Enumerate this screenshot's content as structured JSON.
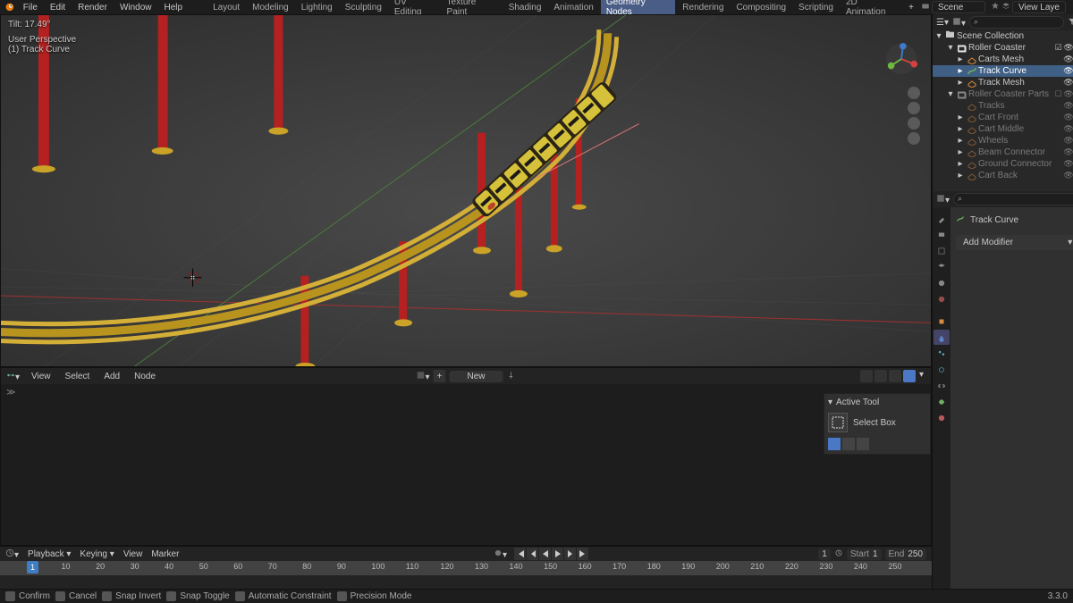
{
  "menu": [
    "File",
    "Edit",
    "Render",
    "Window",
    "Help"
  ],
  "workspaces": [
    "Layout",
    "Modeling",
    "Lighting",
    "Sculpting",
    "UV Editing",
    "Texture Paint",
    "Shading",
    "Animation",
    "Geometry Nodes",
    "Rendering",
    "Compositing",
    "Scripting",
    "2D Animation"
  ],
  "active_workspace": "Geometry Nodes",
  "scene_name": "Scene",
  "view_layer": "View Layer",
  "viewport": {
    "tilt_text": "Tilt: 17.49°",
    "persp_label": "User Perspective",
    "object_label": "(1) Track Curve"
  },
  "node_editor": {
    "menus": [
      "View",
      "Select",
      "Add",
      "Node"
    ],
    "new_label": "New",
    "panel_title": "Active Tool",
    "tool_label": "Select Box"
  },
  "timeline": {
    "menus": [
      "Playback",
      "Keying",
      "View",
      "Marker"
    ],
    "frame_field": "1",
    "start_label": "Start",
    "start_value": "1",
    "end_label": "End",
    "end_value": "250",
    "current": "1",
    "ticks": [
      "10",
      "20",
      "30",
      "40",
      "50",
      "60",
      "70",
      "80",
      "90",
      "100",
      "110",
      "120",
      "130",
      "140",
      "150",
      "160",
      "170",
      "180",
      "190",
      "200",
      "210",
      "220",
      "230",
      "240",
      "250"
    ]
  },
  "outliner": {
    "root": "Scene Collection",
    "items": [
      {
        "indent": 1,
        "toggle": "▾",
        "name": "Roller Coaster",
        "icon": "collection",
        "enabled": true
      },
      {
        "indent": 2,
        "toggle": "▸",
        "name": "Carts Mesh",
        "icon": "mesh",
        "enabled": true
      },
      {
        "indent": 2,
        "toggle": "▸",
        "name": "Track Curve",
        "icon": "curve",
        "enabled": true,
        "selected": true
      },
      {
        "indent": 2,
        "toggle": "▸",
        "name": "Track Mesh",
        "icon": "mesh",
        "enabled": true
      },
      {
        "indent": 1,
        "toggle": "▾",
        "name": "Roller Coaster Parts",
        "icon": "collection",
        "enabled": false
      },
      {
        "indent": 2,
        "toggle": "",
        "name": "Tracks",
        "icon": "mesh",
        "enabled": false
      },
      {
        "indent": 2,
        "toggle": "▸",
        "name": "Cart Front",
        "icon": "mesh",
        "enabled": false
      },
      {
        "indent": 2,
        "toggle": "▸",
        "name": "Cart Middle",
        "icon": "mesh",
        "enabled": false
      },
      {
        "indent": 2,
        "toggle": "▸",
        "name": "Wheels",
        "icon": "mesh",
        "enabled": false
      },
      {
        "indent": 2,
        "toggle": "▸",
        "name": "Beam Connector",
        "icon": "mesh",
        "enabled": false
      },
      {
        "indent": 2,
        "toggle": "▸",
        "name": "Ground Connector",
        "icon": "mesh",
        "enabled": false
      },
      {
        "indent": 2,
        "toggle": "▸",
        "name": "Cart Back",
        "icon": "mesh",
        "enabled": false
      }
    ]
  },
  "properties": {
    "active_object": "Track Curve",
    "add_modifier_label": "Add Modifier"
  },
  "statusbar": {
    "items": [
      "Confirm",
      "Cancel",
      "Snap Invert",
      "Snap Toggle",
      "Automatic Constraint",
      "Precision Mode"
    ],
    "version": "3.3.0"
  },
  "colors": {
    "accent": "#4a78c6",
    "track": "#c9a227",
    "support": "#b52020"
  }
}
